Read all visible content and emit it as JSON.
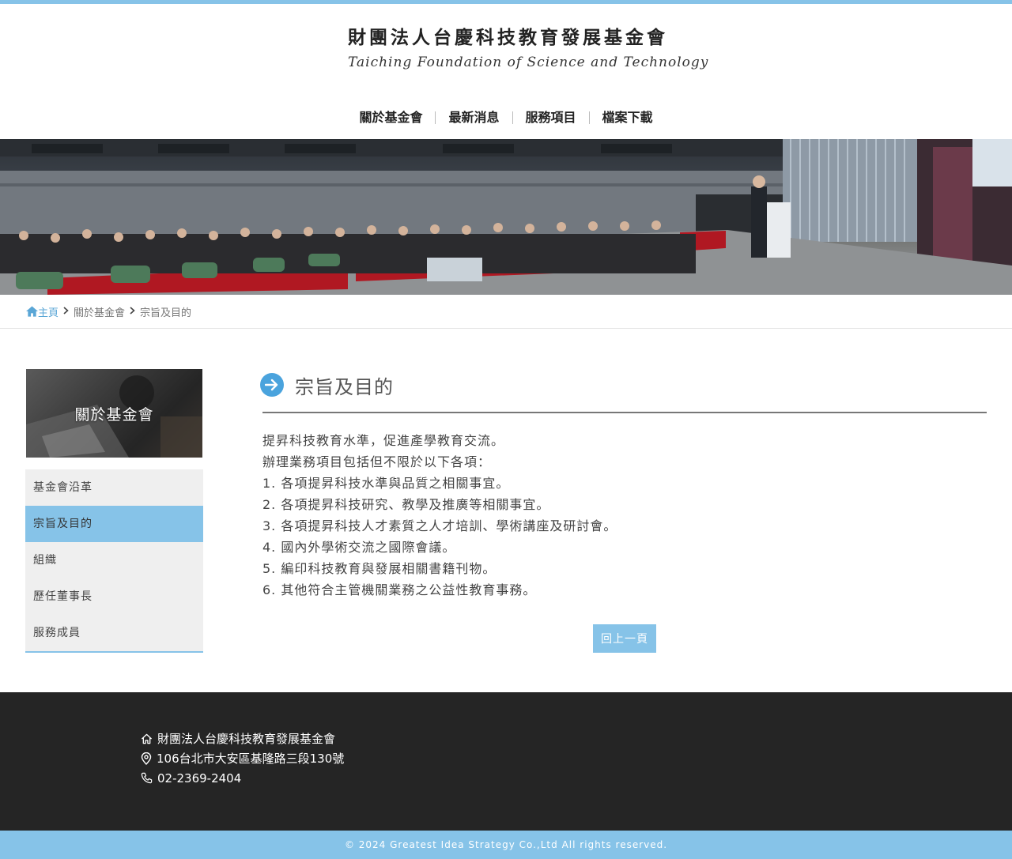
{
  "site": {
    "name_cn": "財團法人台慶科技教育發展基金會",
    "name_en": "Taiching Foundation of Science and Technology"
  },
  "nav": {
    "items": [
      {
        "label": "關於基金會"
      },
      {
        "label": "最新消息"
      },
      {
        "label": "服務項目"
      },
      {
        "label": "檔案下載"
      }
    ]
  },
  "breadcrumb": {
    "home": "主頁",
    "parent": "關於基金會",
    "current": "宗旨及目的"
  },
  "sidebar": {
    "title": "關於基金會",
    "items": [
      {
        "label": "基金會沿革"
      },
      {
        "label": "宗旨及目的"
      },
      {
        "label": "組織"
      },
      {
        "label": "歷任董事長"
      },
      {
        "label": "服務成員"
      }
    ],
    "active_index": 1
  },
  "content": {
    "title": "宗旨及目的",
    "lines": [
      "提昇科技教育水準，促進產學教育交流。",
      "辦理業務項目包括但不限於以下各項：",
      "1. 各項提昇科技水準與品質之相關事宜。",
      "2. 各項提昇科技研究、教學及推廣等相關事宜。",
      "3. 各項提昇科技人才素質之人才培訓、學術講座及研討會。",
      "4. 國內外學術交流之國際會議。",
      "5. 編印科技教育與發展相關書籍刊物。",
      "6. 其他符合主管機關業務之公益性教育事務。"
    ],
    "back_button": "回上一頁"
  },
  "footer": {
    "org": "財團法人台慶科技教育發展基金會",
    "address": "106台北市大安區基隆路三段130號",
    "phone": "02-2369-2404",
    "copyright": "© 2024 Greatest Idea Strategy Co.,Ltd All rights reserved."
  },
  "icons": {
    "home": "home-icon",
    "breadcrumb_sep": "chevron-right-icon",
    "title": "arrow-right-circle-icon",
    "footer_org": "house-icon",
    "footer_address": "map-pin-icon",
    "footer_phone": "phone-icon"
  },
  "colors": {
    "accent": "#86c3e8",
    "title_icon": "#4aa3dd",
    "footer_bg": "#252525"
  }
}
